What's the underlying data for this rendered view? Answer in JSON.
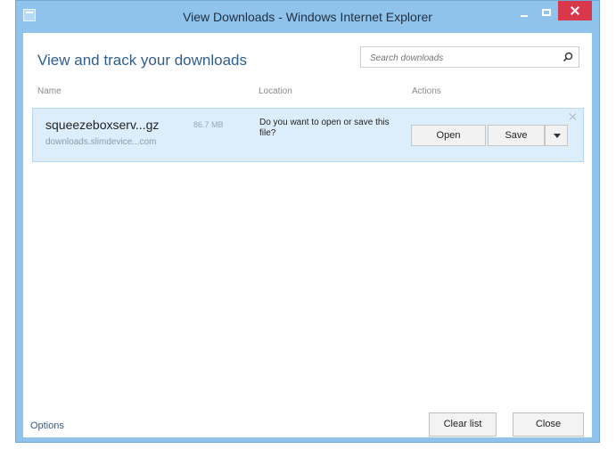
{
  "window": {
    "title": "View Downloads - Windows Internet Explorer"
  },
  "header": {
    "title": "View and track your downloads",
    "search_placeholder": "Search downloads"
  },
  "columns": {
    "name": "Name",
    "location": "Location",
    "actions": "Actions"
  },
  "download": {
    "filename": "squeezeboxserv...gz",
    "size": "86.7 MB",
    "site": "downloads.slimdevice...com",
    "prompt": "Do you want to open or save this file?",
    "open_label": "Open",
    "save_label": "Save"
  },
  "footer": {
    "options_label": "Options",
    "clear_list_label": "Clear list",
    "close_label": "Close"
  },
  "colors": {
    "titlebar": "#8fc3ec",
    "row_highlight": "#dceefc",
    "accent": "#2f5e8e",
    "close": "#d9384a"
  },
  "icons": [
    "app-icon",
    "minimize-icon",
    "maximize-icon",
    "close-icon",
    "search-icon",
    "chevron-down-icon"
  ]
}
